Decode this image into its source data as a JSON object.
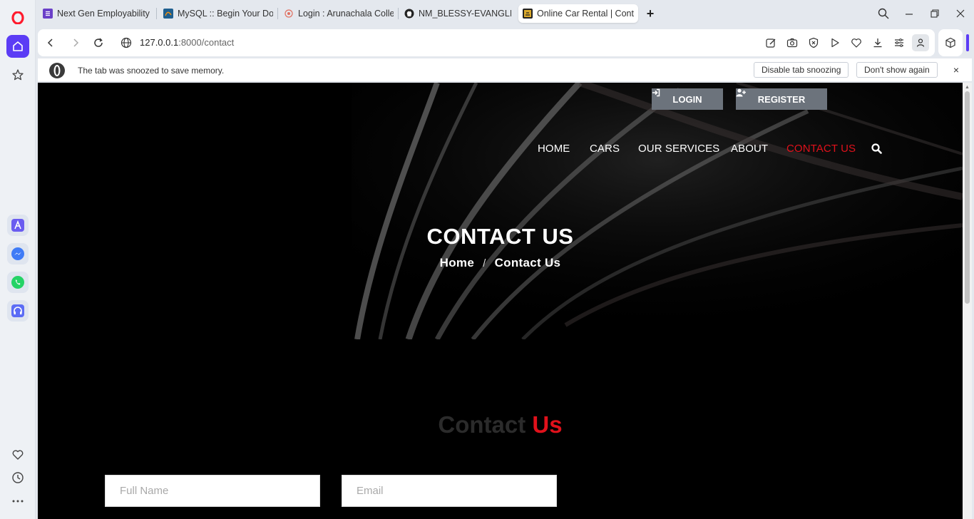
{
  "browser": {
    "tabs": [
      {
        "label": "Next Gen Employability Pr"
      },
      {
        "label": "MySQL :: Begin Your Down"
      },
      {
        "label": "Login : Arunachala College"
      },
      {
        "label": "NM_BLESSY-EVANGLINE_"
      },
      {
        "label": "Online Car Rental | Contac"
      }
    ],
    "url_host": "127.0.0.1",
    "url_rest": ":8000/contact",
    "snooze_message": "The tab was snoozed to save memory.",
    "disable_snoozing_label": "Disable tab snoozing",
    "dont_show_label": "Don't show again",
    "close_glyph": "×",
    "new_tab_glyph": "+"
  },
  "page": {
    "login_label": "LOGIN",
    "register_label": "REGISTER",
    "nav": [
      "HOME",
      "CARS",
      "OUR SERVICES",
      "ABOUT",
      "CONTACT US"
    ],
    "active_nav": "CONTACT US",
    "hero_title": "CONTACT US",
    "breadcrumb_home": "Home",
    "breadcrumb_sep": "/",
    "breadcrumb_current": "Contact Us",
    "section_title_1": "Contact",
    "section_title_2": "Us",
    "form": {
      "full_name_placeholder": "Full Name",
      "email_placeholder": "Email"
    }
  },
  "colors": {
    "accent_red": "#e0111b",
    "opera_purple": "#5b3cf5",
    "button_gray": "#6c737c"
  }
}
